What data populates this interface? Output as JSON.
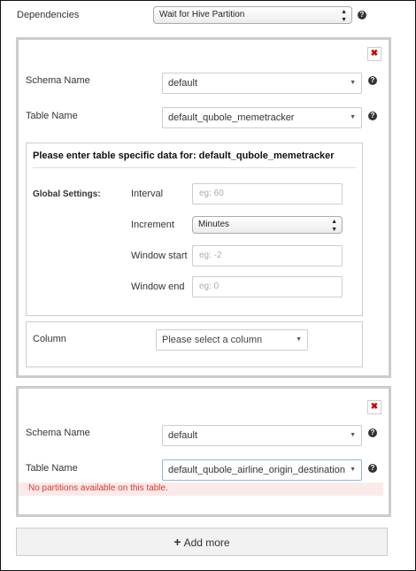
{
  "dependencies": {
    "label": "Dependencies",
    "selected": "Wait for Hive Partition"
  },
  "help_glyph": "?",
  "close_glyph": "✖",
  "panel1": {
    "schema_label": "Schema Name",
    "schema_value": "default",
    "table_label": "Table Name",
    "table_value": "default_qubole_memetracker",
    "table_data": {
      "heading": "Please enter table specific data for: default_qubole_memetracker",
      "global_settings_label": "Global Settings:",
      "interval_label": "Interval",
      "interval_placeholder": "eg: 60",
      "increment_label": "Increment",
      "increment_value": "Minutes",
      "window_start_label": "Window start",
      "window_start_placeholder": "eg: -2",
      "window_end_label": "Window end",
      "window_end_placeholder": "eg: 0"
    },
    "column": {
      "label": "Column",
      "placeholder": "Please select a column"
    }
  },
  "panel2": {
    "schema_label": "Schema Name",
    "schema_value": "default",
    "table_label": "Table Name",
    "table_value": "default_qubole_airline_origin_destination",
    "error": "No partitions available on this table."
  },
  "add_more_label": "Add more",
  "icons": {
    "plus": "plus-icon",
    "close": "close-icon",
    "help": "help-icon",
    "caret": "caret-down-icon",
    "updown": "select-updown-icon"
  },
  "colors": {
    "error_text": "#d9372b",
    "error_bg": "#fbeaea",
    "close_x": "#cc0000",
    "active_border": "#8fb4e6"
  }
}
